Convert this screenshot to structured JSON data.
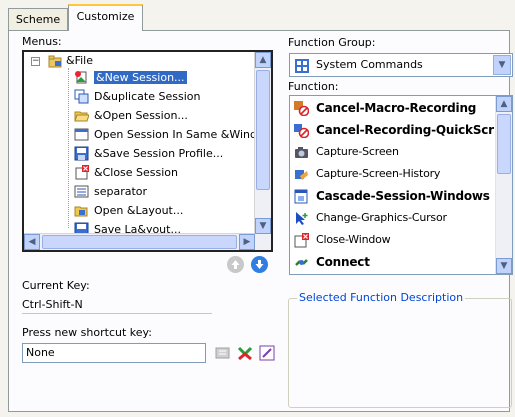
{
  "tabs": [
    {
      "label": "Scheme"
    },
    {
      "label": "Customize"
    }
  ],
  "menus": {
    "label": "Menus:",
    "root": "&File",
    "items": [
      {
        "label": "&New Session...",
        "selected": true
      },
      {
        "label": "D&uplicate Session"
      },
      {
        "label": "&Open Session..."
      },
      {
        "label": "Open Session In Same &Windc"
      },
      {
        "label": "&Save Session Profile..."
      },
      {
        "label": "&Close Session"
      },
      {
        "label": "separator"
      },
      {
        "label": "Open &Layout..."
      },
      {
        "label": "Save La&yout..."
      }
    ]
  },
  "function_group": {
    "label": "Function Group:",
    "value": "System Commands"
  },
  "function": {
    "label": "Function:",
    "items": [
      {
        "label": "Cancel-Macro-Recording",
        "bold": true
      },
      {
        "label": "Cancel-Recording-QuickScr",
        "bold": true
      },
      {
        "label": "Capture-Screen",
        "bold": false
      },
      {
        "label": "Capture-Screen-History",
        "bold": false
      },
      {
        "label": "Cascade-Session-Windows",
        "bold": true
      },
      {
        "label": "Change-Graphics-Cursor",
        "bold": false
      },
      {
        "label": "Close-Window",
        "bold": false
      },
      {
        "label": "Connect",
        "bold": true
      }
    ]
  },
  "current_key": {
    "label": "Current Key:",
    "value": "Ctrl-Shift-N"
  },
  "new_shortcut": {
    "label": "Press new shortcut key:",
    "value": "None"
  },
  "description": {
    "label": "Selected Function Description"
  },
  "colors": {
    "accent": "#316ac5",
    "legend": "#0046d5",
    "tab_highlight": "#ffc83c"
  }
}
